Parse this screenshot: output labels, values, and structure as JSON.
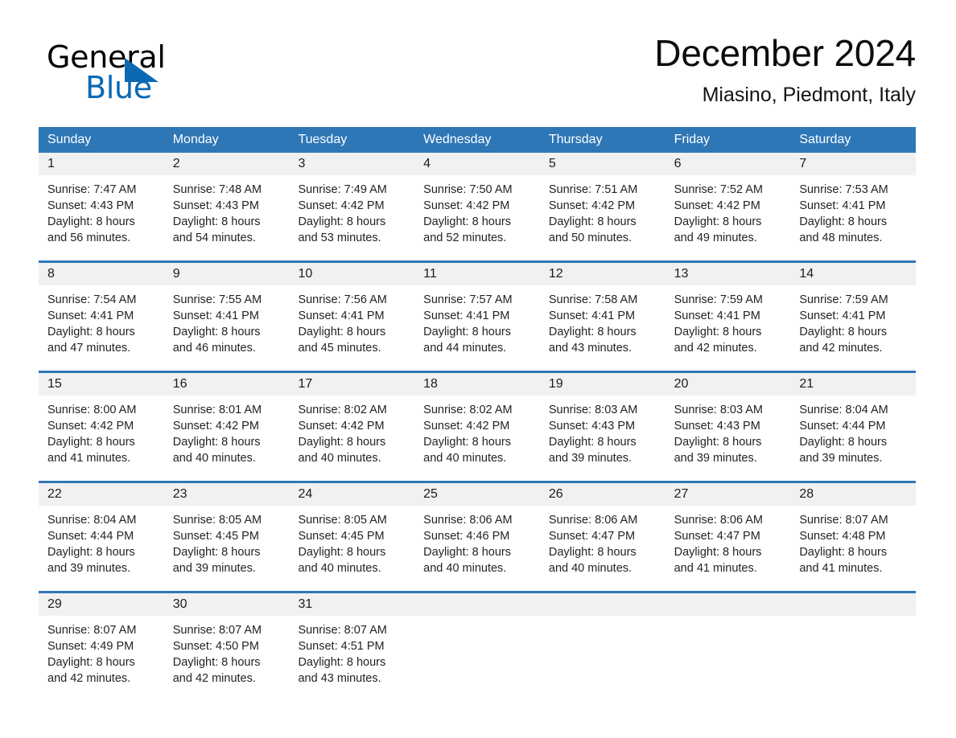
{
  "logo": {
    "word_one": "General",
    "word_two": "Blue",
    "triangle_icon": "blue-triangle-icon",
    "accent_color": "#0a69b5"
  },
  "header": {
    "title": "December 2024",
    "subtitle": "Miasino, Piedmont, Italy"
  },
  "colors": {
    "header_blue": "#2e77b7",
    "day_band_gray": "#f1f1f1",
    "text": "#232323"
  },
  "calendar": {
    "weekdays": [
      "Sunday",
      "Monday",
      "Tuesday",
      "Wednesday",
      "Thursday",
      "Friday",
      "Saturday"
    ],
    "weeks": [
      [
        {
          "day": "1",
          "lines": [
            "Sunrise: 7:47 AM",
            "Sunset: 4:43 PM",
            "Daylight: 8 hours",
            "and 56 minutes."
          ]
        },
        {
          "day": "2",
          "lines": [
            "Sunrise: 7:48 AM",
            "Sunset: 4:43 PM",
            "Daylight: 8 hours",
            "and 54 minutes."
          ]
        },
        {
          "day": "3",
          "lines": [
            "Sunrise: 7:49 AM",
            "Sunset: 4:42 PM",
            "Daylight: 8 hours",
            "and 53 minutes."
          ]
        },
        {
          "day": "4",
          "lines": [
            "Sunrise: 7:50 AM",
            "Sunset: 4:42 PM",
            "Daylight: 8 hours",
            "and 52 minutes."
          ]
        },
        {
          "day": "5",
          "lines": [
            "Sunrise: 7:51 AM",
            "Sunset: 4:42 PM",
            "Daylight: 8 hours",
            "and 50 minutes."
          ]
        },
        {
          "day": "6",
          "lines": [
            "Sunrise: 7:52 AM",
            "Sunset: 4:42 PM",
            "Daylight: 8 hours",
            "and 49 minutes."
          ]
        },
        {
          "day": "7",
          "lines": [
            "Sunrise: 7:53 AM",
            "Sunset: 4:41 PM",
            "Daylight: 8 hours",
            "and 48 minutes."
          ]
        }
      ],
      [
        {
          "day": "8",
          "lines": [
            "Sunrise: 7:54 AM",
            "Sunset: 4:41 PM",
            "Daylight: 8 hours",
            "and 47 minutes."
          ]
        },
        {
          "day": "9",
          "lines": [
            "Sunrise: 7:55 AM",
            "Sunset: 4:41 PM",
            "Daylight: 8 hours",
            "and 46 minutes."
          ]
        },
        {
          "day": "10",
          "lines": [
            "Sunrise: 7:56 AM",
            "Sunset: 4:41 PM",
            "Daylight: 8 hours",
            "and 45 minutes."
          ]
        },
        {
          "day": "11",
          "lines": [
            "Sunrise: 7:57 AM",
            "Sunset: 4:41 PM",
            "Daylight: 8 hours",
            "and 44 minutes."
          ]
        },
        {
          "day": "12",
          "lines": [
            "Sunrise: 7:58 AM",
            "Sunset: 4:41 PM",
            "Daylight: 8 hours",
            "and 43 minutes."
          ]
        },
        {
          "day": "13",
          "lines": [
            "Sunrise: 7:59 AM",
            "Sunset: 4:41 PM",
            "Daylight: 8 hours",
            "and 42 minutes."
          ]
        },
        {
          "day": "14",
          "lines": [
            "Sunrise: 7:59 AM",
            "Sunset: 4:41 PM",
            "Daylight: 8 hours",
            "and 42 minutes."
          ]
        }
      ],
      [
        {
          "day": "15",
          "lines": [
            "Sunrise: 8:00 AM",
            "Sunset: 4:42 PM",
            "Daylight: 8 hours",
            "and 41 minutes."
          ]
        },
        {
          "day": "16",
          "lines": [
            "Sunrise: 8:01 AM",
            "Sunset: 4:42 PM",
            "Daylight: 8 hours",
            "and 40 minutes."
          ]
        },
        {
          "day": "17",
          "lines": [
            "Sunrise: 8:02 AM",
            "Sunset: 4:42 PM",
            "Daylight: 8 hours",
            "and 40 minutes."
          ]
        },
        {
          "day": "18",
          "lines": [
            "Sunrise: 8:02 AM",
            "Sunset: 4:42 PM",
            "Daylight: 8 hours",
            "and 40 minutes."
          ]
        },
        {
          "day": "19",
          "lines": [
            "Sunrise: 8:03 AM",
            "Sunset: 4:43 PM",
            "Daylight: 8 hours",
            "and 39 minutes."
          ]
        },
        {
          "day": "20",
          "lines": [
            "Sunrise: 8:03 AM",
            "Sunset: 4:43 PM",
            "Daylight: 8 hours",
            "and 39 minutes."
          ]
        },
        {
          "day": "21",
          "lines": [
            "Sunrise: 8:04 AM",
            "Sunset: 4:44 PM",
            "Daylight: 8 hours",
            "and 39 minutes."
          ]
        }
      ],
      [
        {
          "day": "22",
          "lines": [
            "Sunrise: 8:04 AM",
            "Sunset: 4:44 PM",
            "Daylight: 8 hours",
            "and 39 minutes."
          ]
        },
        {
          "day": "23",
          "lines": [
            "Sunrise: 8:05 AM",
            "Sunset: 4:45 PM",
            "Daylight: 8 hours",
            "and 39 minutes."
          ]
        },
        {
          "day": "24",
          "lines": [
            "Sunrise: 8:05 AM",
            "Sunset: 4:45 PM",
            "Daylight: 8 hours",
            "and 40 minutes."
          ]
        },
        {
          "day": "25",
          "lines": [
            "Sunrise: 8:06 AM",
            "Sunset: 4:46 PM",
            "Daylight: 8 hours",
            "and 40 minutes."
          ]
        },
        {
          "day": "26",
          "lines": [
            "Sunrise: 8:06 AM",
            "Sunset: 4:47 PM",
            "Daylight: 8 hours",
            "and 40 minutes."
          ]
        },
        {
          "day": "27",
          "lines": [
            "Sunrise: 8:06 AM",
            "Sunset: 4:47 PM",
            "Daylight: 8 hours",
            "and 41 minutes."
          ]
        },
        {
          "day": "28",
          "lines": [
            "Sunrise: 8:07 AM",
            "Sunset: 4:48 PM",
            "Daylight: 8 hours",
            "and 41 minutes."
          ]
        }
      ],
      [
        {
          "day": "29",
          "lines": [
            "Sunrise: 8:07 AM",
            "Sunset: 4:49 PM",
            "Daylight: 8 hours",
            "and 42 minutes."
          ]
        },
        {
          "day": "30",
          "lines": [
            "Sunrise: 8:07 AM",
            "Sunset: 4:50 PM",
            "Daylight: 8 hours",
            "and 42 minutes."
          ]
        },
        {
          "day": "31",
          "lines": [
            "Sunrise: 8:07 AM",
            "Sunset: 4:51 PM",
            "Daylight: 8 hours",
            "and 43 minutes."
          ]
        },
        {
          "day": "",
          "lines": []
        },
        {
          "day": "",
          "lines": []
        },
        {
          "day": "",
          "lines": []
        },
        {
          "day": "",
          "lines": []
        }
      ]
    ]
  }
}
